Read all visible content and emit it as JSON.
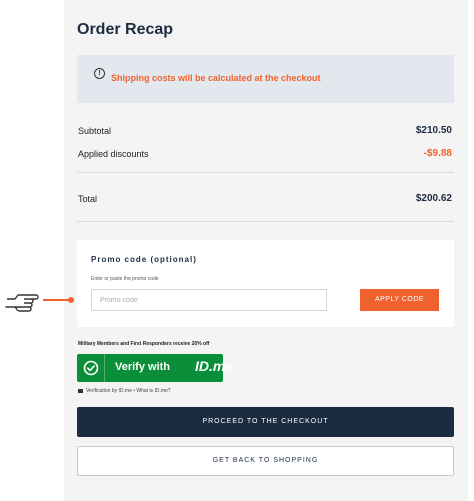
{
  "recap": {
    "title": "Order Recap",
    "shipping_notice": "Shipping costs will be calculated at the checkout",
    "subtotal_label": "Subtotal",
    "subtotal_value": "$210.50",
    "discounts_label": "Applied discounts",
    "discounts_value": "-$9.88",
    "total_label": "Total",
    "total_value": "$200.62"
  },
  "promo": {
    "title": "Promo code (optional)",
    "subtitle": "Enter or paste the promo code",
    "placeholder": "Promo code",
    "apply_label": "APPLY CODE"
  },
  "military": {
    "text": "Military Members and First Responders receive 20% off",
    "verify_label": "Verify with",
    "logo_text": "ID.me",
    "verification_text": "Verification by ID.me • What is ID.me?"
  },
  "actions": {
    "checkout_label": "PROCEED TO THE CHECKOUT",
    "back_label": "GET BACK TO SHOPPING"
  },
  "colors": {
    "accent": "#f0622d",
    "navy": "#1c2c40",
    "idme_green": "#0b8e3a"
  },
  "icons": {
    "notice": "info-icon",
    "pointer": "pointing-hand-icon",
    "verify": "check-circle-icon",
    "lock": "lock-icon"
  }
}
